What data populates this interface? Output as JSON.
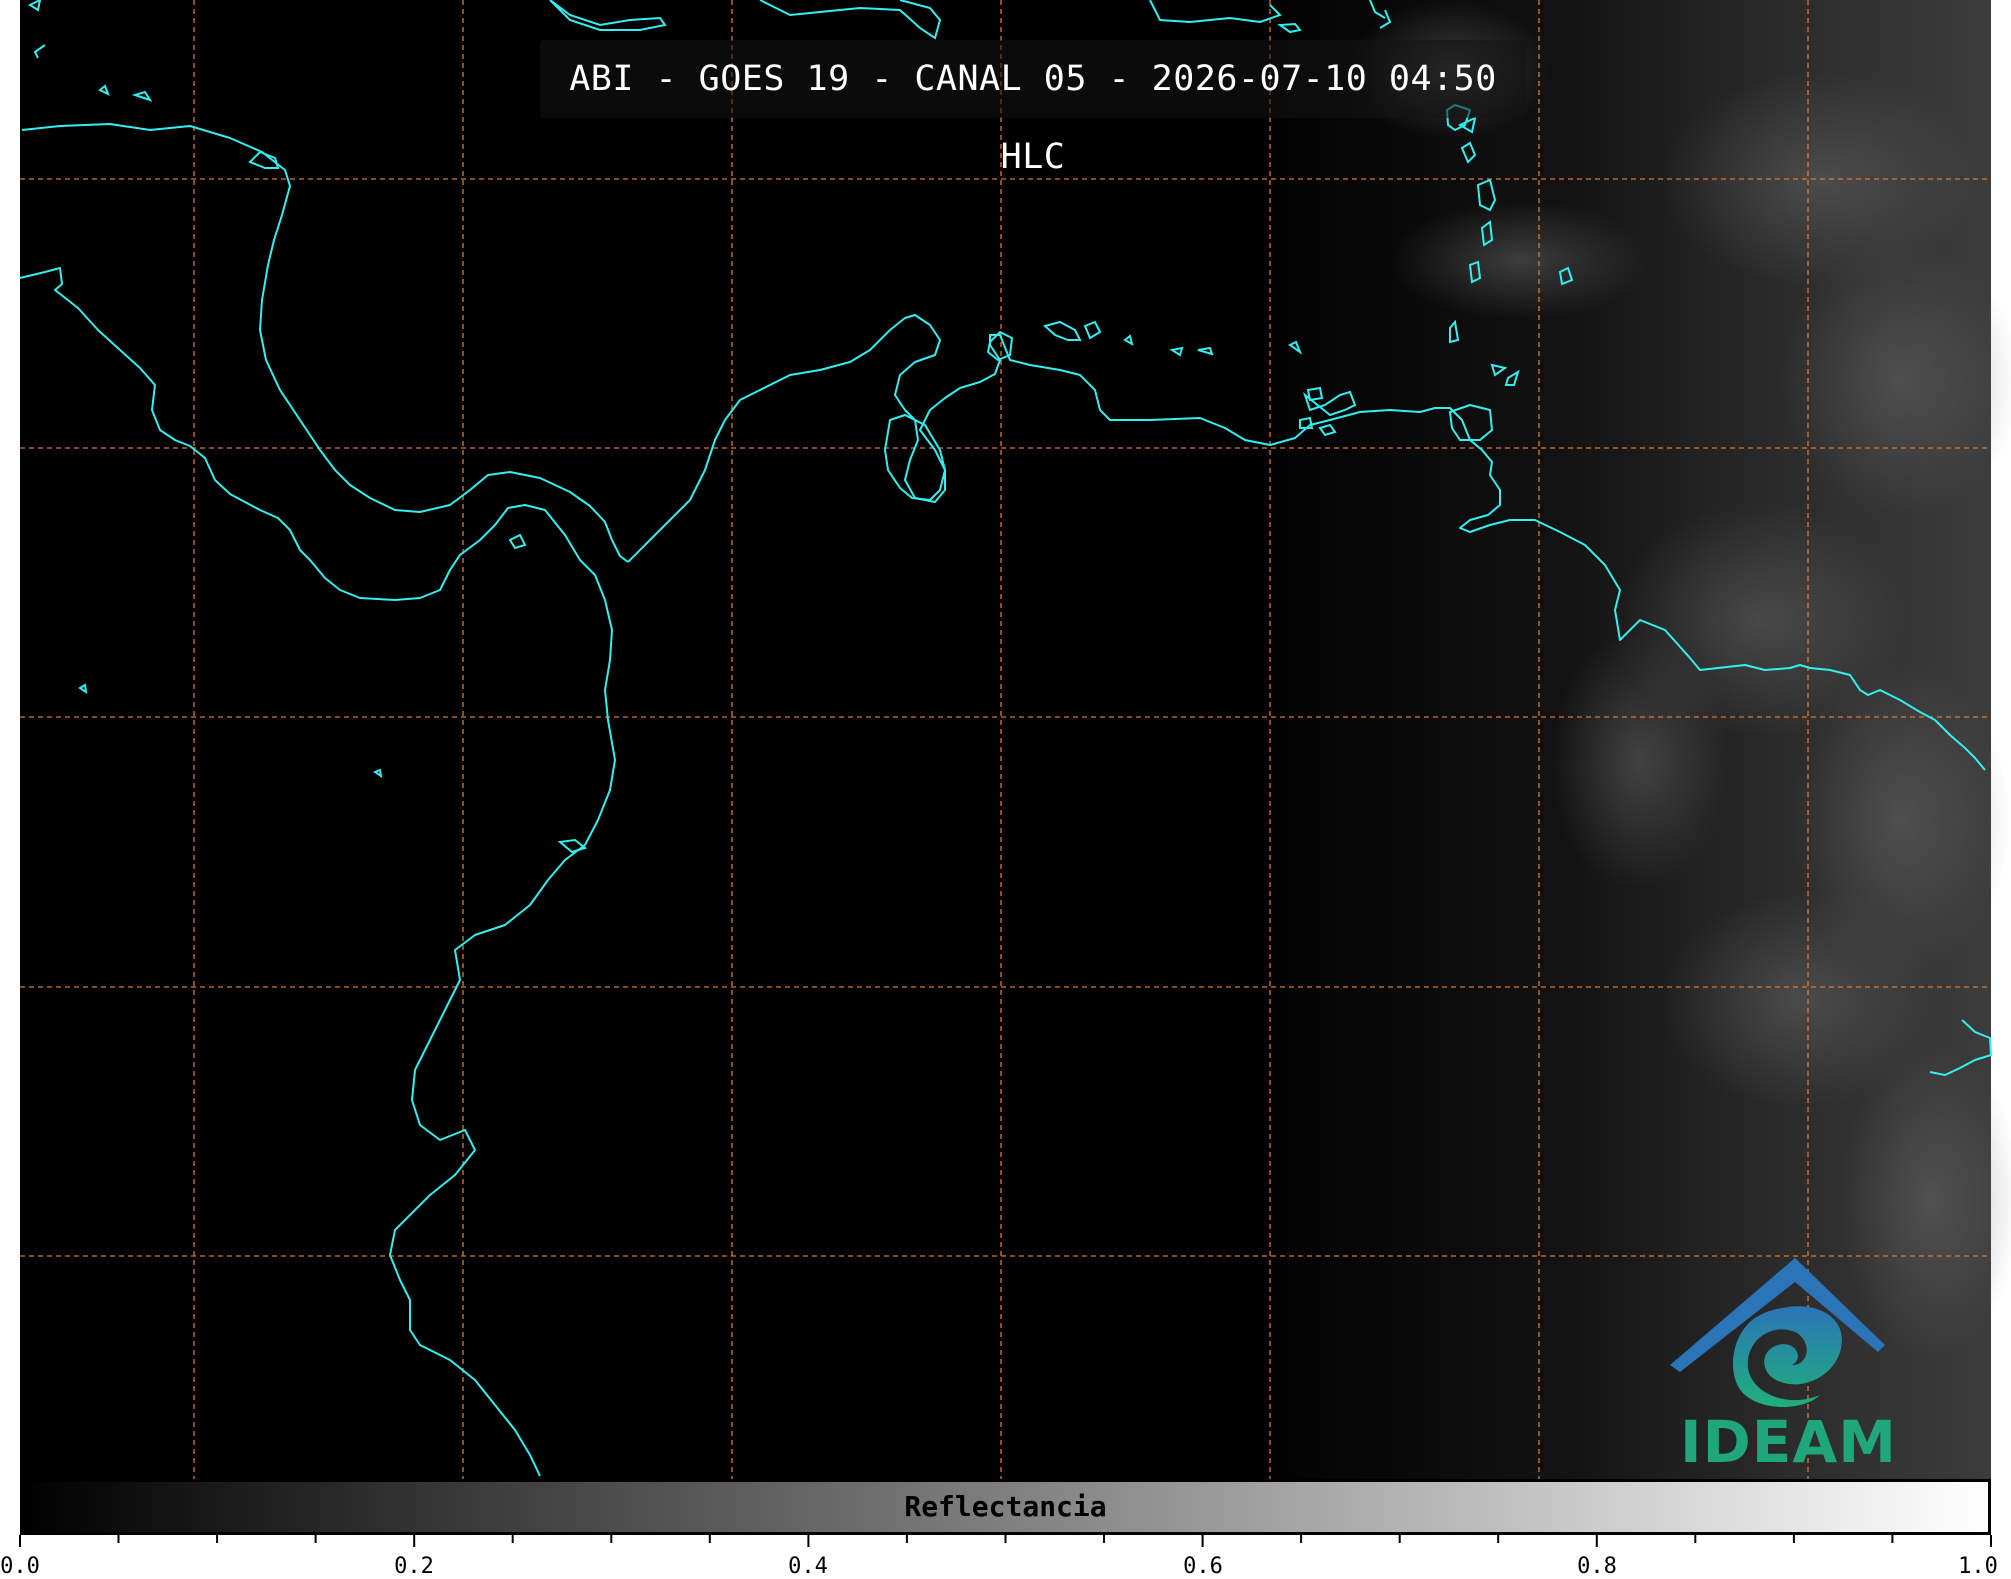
{
  "title": "ABI - GOES 19 - CANAL 05 - 2026-07-10 04:50 HLC",
  "colorbar": {
    "label": "Reflectancia",
    "ticks": [
      "0.0",
      "0.2",
      "0.4",
      "0.6",
      "0.8",
      "1.0"
    ],
    "range": [
      0.0,
      1.0
    ]
  },
  "logo": {
    "text": "IDEAM"
  },
  "colors": {
    "coastline": "#33f0f0",
    "gridline": "#e0782a",
    "background": "#000000",
    "logo_teal": "#1fa67a",
    "logo_blue": "#2b74b8"
  }
}
